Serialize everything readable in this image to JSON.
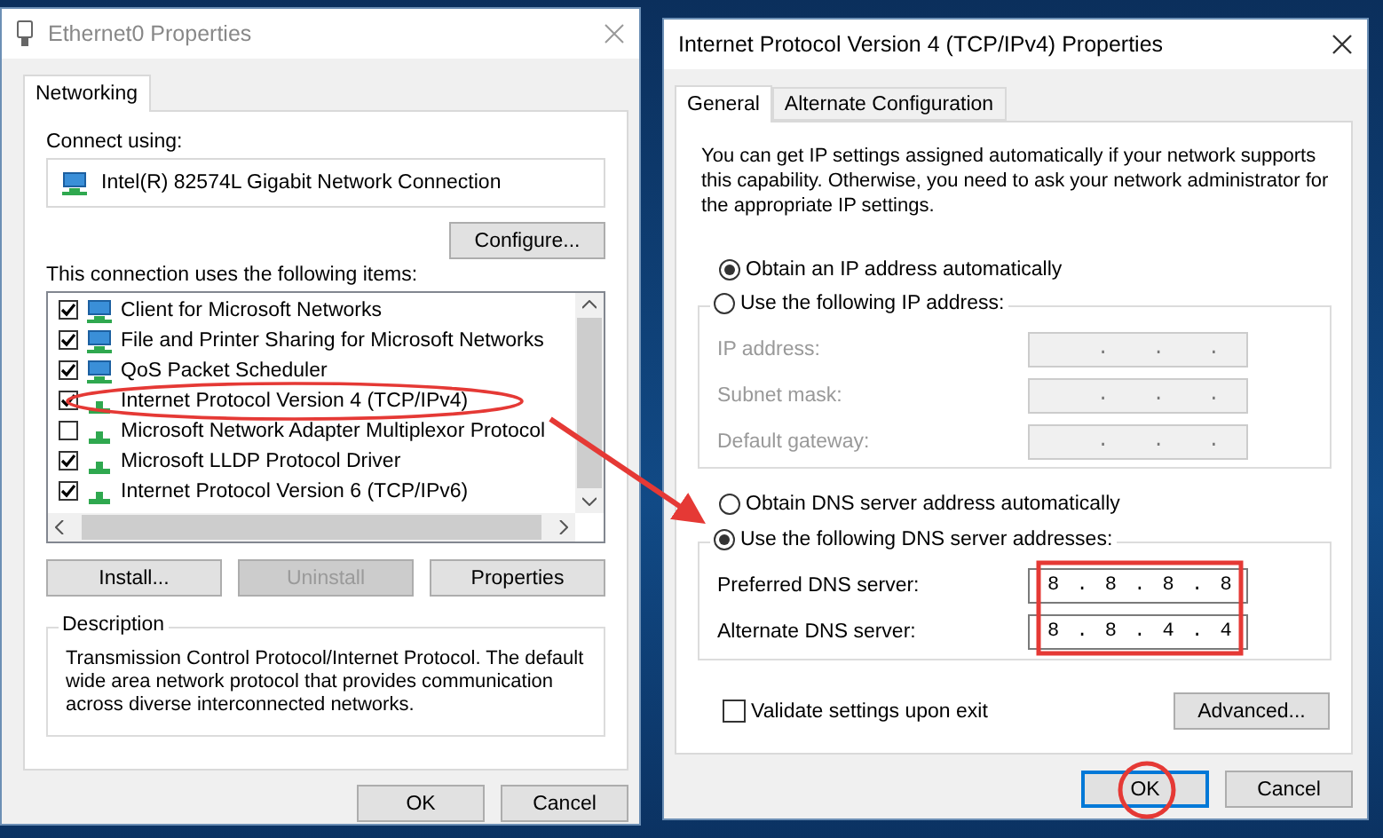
{
  "left_dialog": {
    "title": "Ethernet0 Properties",
    "tabs": [
      {
        "label": "Networking",
        "selected": true
      }
    ],
    "connect_using_label": "Connect using:",
    "adapter": "Intel(R) 82574L Gigabit Network Connection",
    "configure_button": "Configure...",
    "items_label": "This connection uses the following items:",
    "items": [
      {
        "label": "Client for Microsoft Networks",
        "checked": true,
        "kind": "network"
      },
      {
        "label": "File and Printer Sharing for Microsoft Networks",
        "checked": true,
        "kind": "network"
      },
      {
        "label": "QoS Packet Scheduler",
        "checked": true,
        "kind": "network"
      },
      {
        "label": "Internet Protocol Version 4 (TCP/IPv4)",
        "checked": true,
        "kind": "protocol"
      },
      {
        "label": "Microsoft Network Adapter Multiplexor Protocol",
        "checked": false,
        "kind": "protocol"
      },
      {
        "label": "Microsoft LLDP Protocol Driver",
        "checked": true,
        "kind": "protocol"
      },
      {
        "label": "Internet Protocol Version 6 (TCP/IPv6)",
        "checked": true,
        "kind": "protocol"
      }
    ],
    "item_buttons": [
      {
        "label": "Install...",
        "disabled": false
      },
      {
        "label": "Uninstall",
        "disabled": true
      },
      {
        "label": "Properties",
        "disabled": false
      }
    ],
    "description_title": "Description",
    "description": "Transmission Control Protocol/Internet Protocol. The default wide area network protocol that provides communication across diverse interconnected networks.",
    "buttons": [
      "OK",
      "Cancel"
    ]
  },
  "right_dialog": {
    "title": "Internet Protocol Version 4 (TCP/IPv4) Properties",
    "tabs": [
      {
        "label": "General",
        "selected": true
      },
      {
        "label": "Alternate Configuration",
        "selected": false
      }
    ],
    "intro": "You can get IP settings assigned automatically if your network supports this capability. Otherwise, you need to ask your network administrator for the appropriate IP settings.",
    "ip_auto": {
      "label": "Obtain an IP address automatically",
      "selected": true
    },
    "ip_manual": {
      "label": "Use the following IP address:",
      "selected": false
    },
    "ip_fields": [
      {
        "label": "IP address:",
        "value": ". . .",
        "disabled": true
      },
      {
        "label": "Subnet mask:",
        "value": ". . .",
        "disabled": true
      },
      {
        "label": "Default gateway:",
        "value": ". . .",
        "disabled": true
      }
    ],
    "dns_auto": {
      "label": "Obtain DNS server address automatically",
      "selected": false
    },
    "dns_manual": {
      "label": "Use the following DNS server addresses:",
      "selected": true
    },
    "dns_fields": [
      {
        "label": "Preferred DNS server:",
        "value": "8 . 8 . 8 . 8",
        "disabled": false
      },
      {
        "label": "Alternate DNS server:",
        "value": "8 . 8 . 4 . 4",
        "disabled": false
      }
    ],
    "validate": {
      "label": "Validate settings upon exit",
      "checked": false
    },
    "advanced_button": "Advanced...",
    "buttons": [
      "OK",
      "Cancel"
    ]
  }
}
